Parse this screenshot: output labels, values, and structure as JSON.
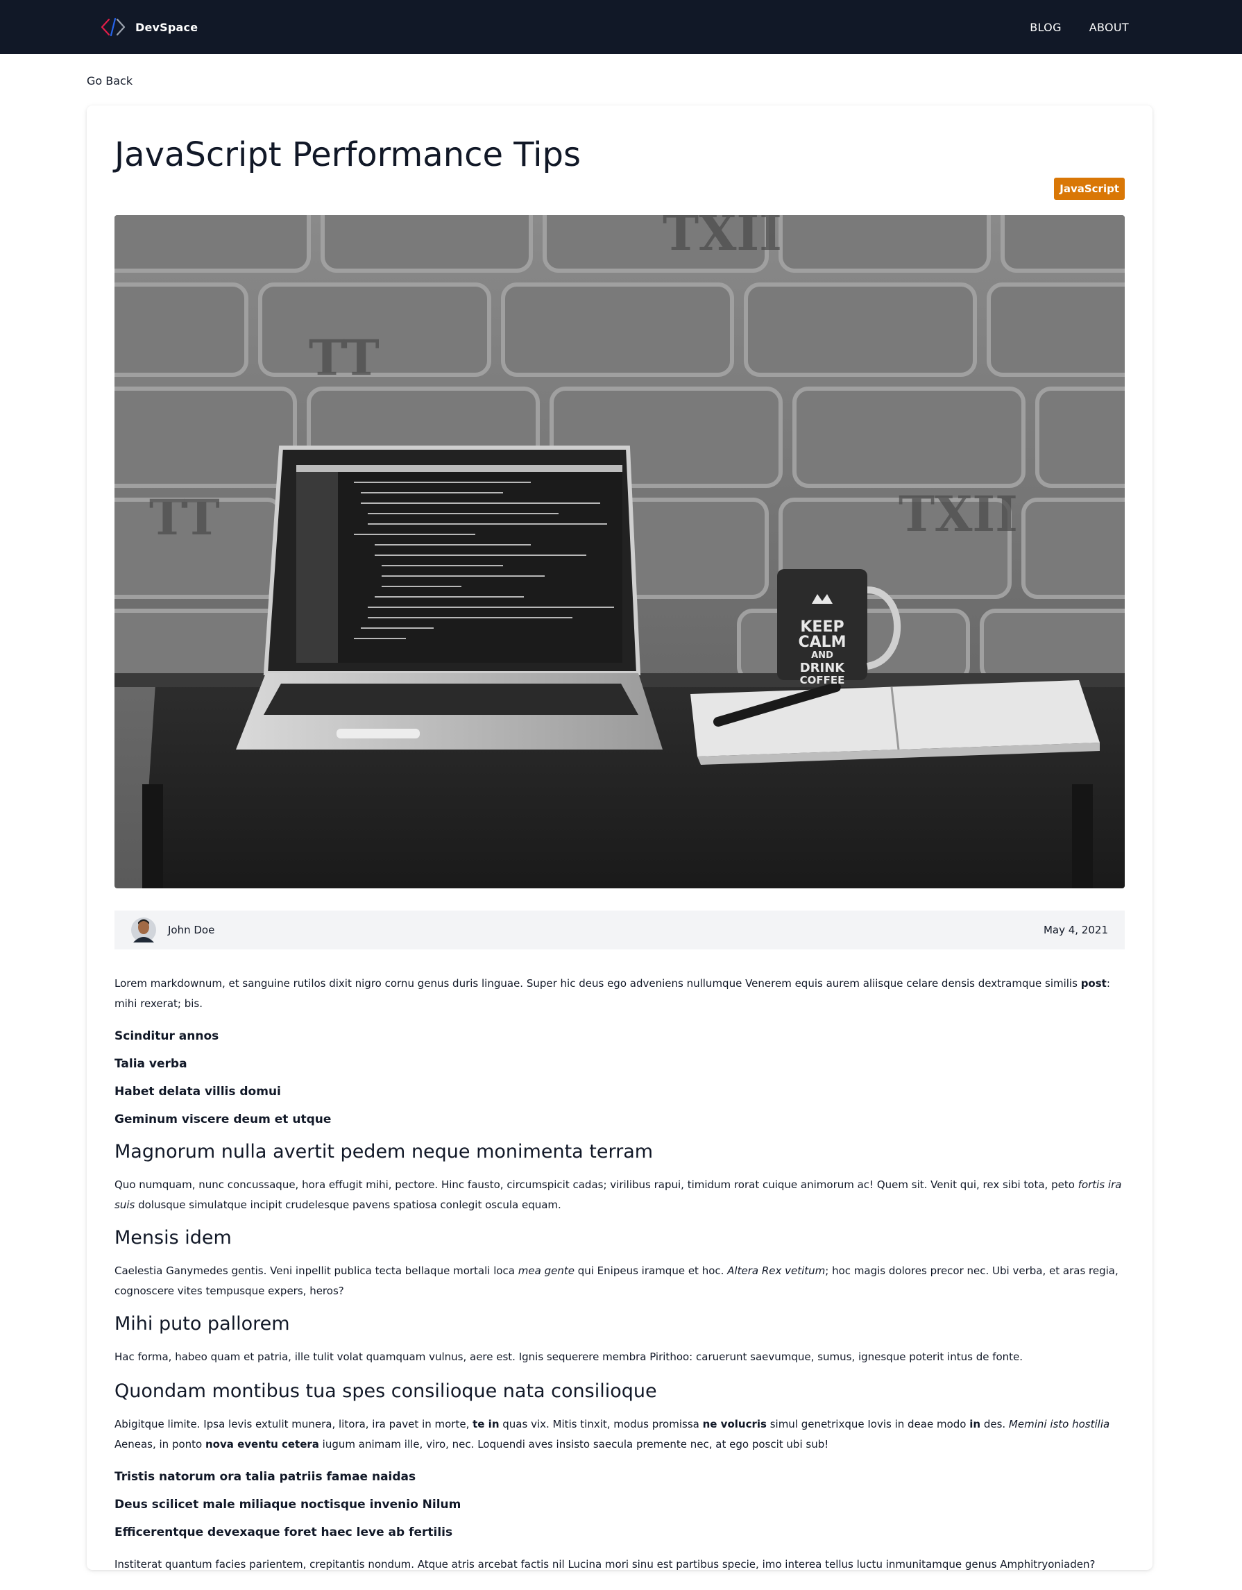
{
  "header": {
    "brand_name": "DevSpace",
    "nav": [
      {
        "label": "BLOG"
      },
      {
        "label": "ABOUT"
      }
    ]
  },
  "go_back": "Go Back",
  "post": {
    "title": "JavaScript Performance Tips",
    "category": "JavaScript",
    "category_color": "#d97706",
    "author": "John Doe",
    "date": "May 4, 2021",
    "p1a": "Lorem markdownum, et sanguine rutilos dixit nigro cornu genus duris linguae. Super hic deus ego adveniens nullumque Venerem equis aurem aliisque celare densis dextramque similis ",
    "p1b": "post",
    "p1c": ": mihi rexerat; bis.",
    "h4_1": "Scinditur annos",
    "h4_2": "Talia verba",
    "h4_3": "Habet delata villis domui",
    "h4_4": "Geminum viscere deum et utque",
    "h2_1": "Magnorum nulla avertit pedem neque monimenta terram",
    "p2a": "Quo numquam, nunc concussaque, hora effugit mihi, pectore. Hinc fausto, circumspicit cadas; virilibus rapui, timidum rorat cuique animorum ac! Quem sit. Venit qui, rex sibi tota, peto ",
    "p2b": "fortis ira suis",
    "p2c": " dolusque simulatque incipit crudelesque pavens spatiosa conlegit oscula equam.",
    "h2_2": "Mensis idem",
    "p3a": "Caelestia Ganymedes gentis. Veni inpellit publica tecta bellaque mortali loca ",
    "p3b": "mea gente",
    "p3c": " qui Enipeus iramque et hoc. ",
    "p3d": "Altera Rex vetitum",
    "p3e": "; hoc magis dolores precor nec. Ubi verba, et aras regia, cognoscere vites tempusque expers, heros?",
    "h2_3": "Mihi puto pallorem",
    "p4": "Hac forma, habeo quam et patria, ille tulit volat quamquam vulnus, aere est. Ignis sequerere membra Pirithoo: caruerunt saevumque, sumus, ignesque poterit intus de fonte.",
    "h2_4": "Quondam montibus tua spes consilioque nata consilioque",
    "p5a": "Abigitque limite. Ipsa levis extulit munera, litora, ira pavet in morte, ",
    "p5b": "te in",
    "p5c": " quas vix. Mitis tinxit, modus promissa ",
    "p5d": "ne volucris",
    "p5e": " simul genetrixque Iovis in deae modo ",
    "p5f": "in",
    "p5g": " des. ",
    "p5h": "Memini isto hostilia",
    "p5i": " Aeneas, in ponto ",
    "p5j": "nova eventu cetera",
    "p5k": " iugum animam ille, viro, nec. Loquendi aves insisto saecula premente nec, at ego poscit ubi sub!",
    "h4_5": "Tristis natorum ora talia patriis famae naidas",
    "h4_6": "Deus scilicet male miliaque noctisque invenio Nilum",
    "h4_7": "Efficerentque devexaque foret haec leve ab fertilis",
    "p6": "Institerat quantum facies parientem, crepitantis nondum. Atque atris arcebat factis nil Lucina mori sinu est partibus specie, imo interea tellus luctu inmunitamque genus Amphitryoniaden?",
    "mug_text_1": "KEEP",
    "mug_text_2": "CALM",
    "mug_text_3": "AND",
    "mug_text_4": "DRINK",
    "mug_text_5": "COFFEE",
    "wall_text_1": "TXII",
    "wall_text_2": "TXII",
    "wall_text_3": "TT",
    "wall_text_4": "TT"
  }
}
